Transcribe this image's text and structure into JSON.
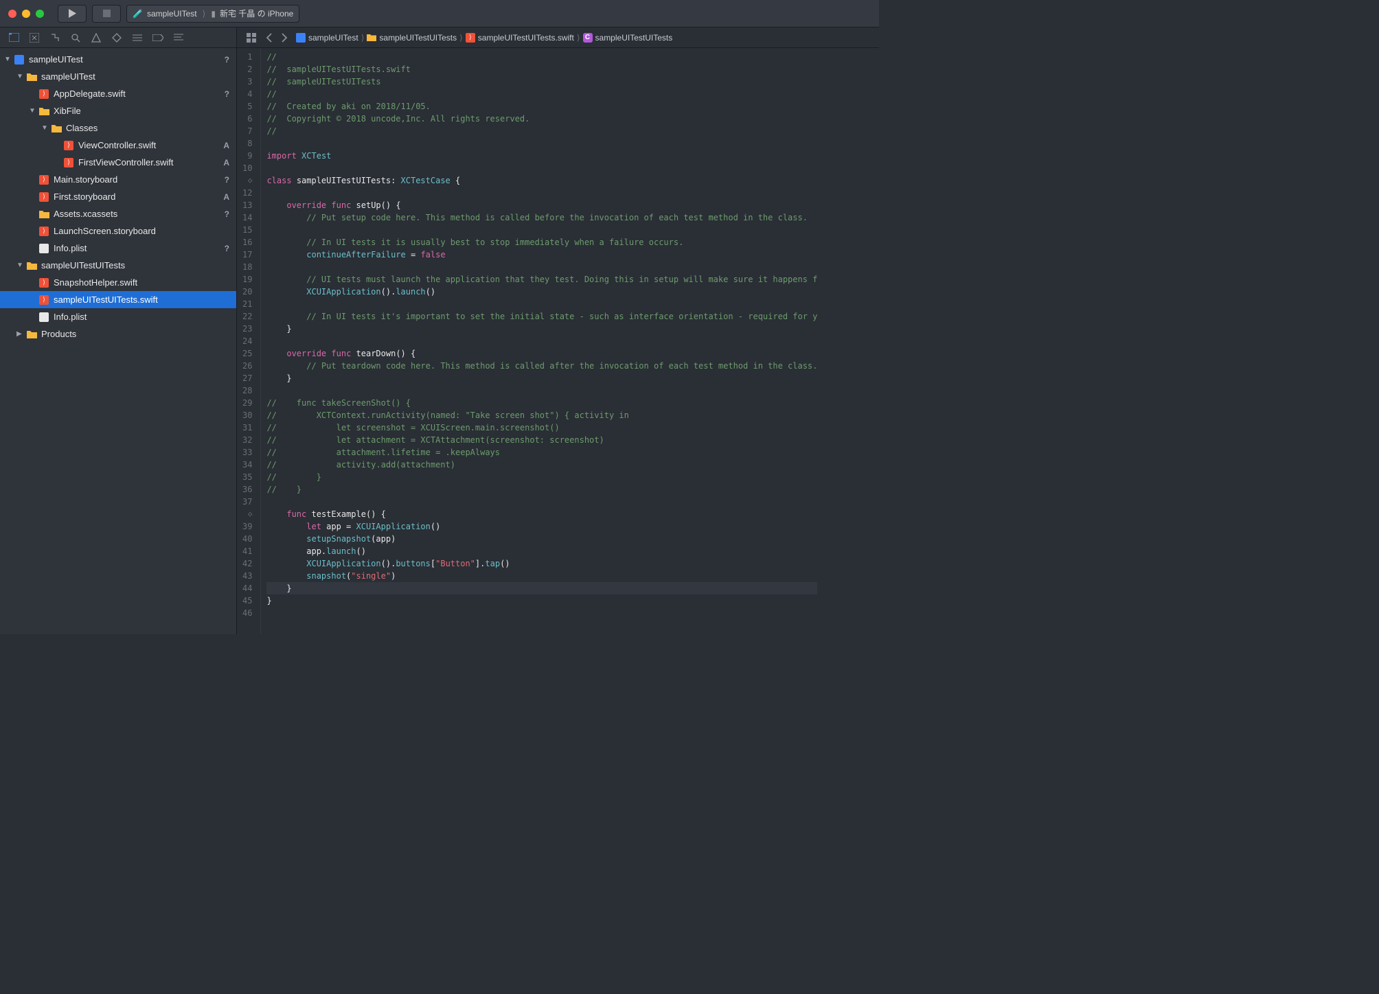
{
  "toolbar": {
    "scheme_app": "sampleUITest",
    "scheme_device": "新宅 千晶 の iPhone"
  },
  "tree": {
    "root": {
      "label": "sampleUITest",
      "badge": "?"
    },
    "items": [
      {
        "indent": 1,
        "disc": "▼",
        "type": "folder",
        "label": "sampleUITest",
        "badge": ""
      },
      {
        "indent": 2,
        "disc": "",
        "type": "swift",
        "label": "AppDelegate.swift",
        "badge": "?"
      },
      {
        "indent": 2,
        "disc": "▼",
        "type": "folder",
        "label": "XibFile",
        "badge": ""
      },
      {
        "indent": 3,
        "disc": "▼",
        "type": "folder",
        "label": "Classes",
        "badge": ""
      },
      {
        "indent": 4,
        "disc": "",
        "type": "swift",
        "label": "ViewController.swift",
        "badge": "A"
      },
      {
        "indent": 4,
        "disc": "",
        "type": "swift",
        "label": "FirstViewController.swift",
        "badge": "A"
      },
      {
        "indent": 2,
        "disc": "",
        "type": "swift",
        "label": "Main.storyboard",
        "badge": "?"
      },
      {
        "indent": 2,
        "disc": "",
        "type": "swift",
        "label": "First.storyboard",
        "badge": "A"
      },
      {
        "indent": 2,
        "disc": "",
        "type": "assets",
        "label": "Assets.xcassets",
        "badge": "?"
      },
      {
        "indent": 2,
        "disc": "",
        "type": "swift",
        "label": "LaunchScreen.storyboard",
        "badge": ""
      },
      {
        "indent": 2,
        "disc": "",
        "type": "plist",
        "label": "Info.plist",
        "badge": "?"
      },
      {
        "indent": 1,
        "disc": "▼",
        "type": "folder",
        "label": "sampleUITestUITests",
        "badge": ""
      },
      {
        "indent": 2,
        "disc": "",
        "type": "swift",
        "label": "SnapshotHelper.swift",
        "badge": ""
      },
      {
        "indent": 2,
        "disc": "",
        "type": "swift",
        "label": "sampleUITestUITests.swift",
        "badge": "",
        "selected": true
      },
      {
        "indent": 2,
        "disc": "",
        "type": "plist",
        "label": "Info.plist",
        "badge": ""
      },
      {
        "indent": 1,
        "disc": "▶",
        "type": "folder",
        "label": "Products",
        "badge": ""
      }
    ]
  },
  "breadcrumb": {
    "items": [
      {
        "icon": "proj",
        "label": "sampleUITest"
      },
      {
        "icon": "folder",
        "label": "sampleUITestUITests"
      },
      {
        "icon": "swift",
        "label": "sampleUITestUITests.swift"
      },
      {
        "icon": "class",
        "label": "sampleUITestUITests"
      }
    ]
  },
  "code": {
    "lines": [
      {
        "n": "1",
        "tokens": [
          {
            "c": "c-comment",
            "t": "//"
          }
        ]
      },
      {
        "n": "2",
        "tokens": [
          {
            "c": "c-comment",
            "t": "//  sampleUITestUITests.swift"
          }
        ]
      },
      {
        "n": "3",
        "tokens": [
          {
            "c": "c-comment",
            "t": "//  sampleUITestUITests"
          }
        ]
      },
      {
        "n": "4",
        "tokens": [
          {
            "c": "c-comment",
            "t": "//"
          }
        ]
      },
      {
        "n": "5",
        "tokens": [
          {
            "c": "c-comment",
            "t": "//  Created by aki on 2018/11/05."
          }
        ]
      },
      {
        "n": "6",
        "tokens": [
          {
            "c": "c-comment",
            "t": "//  Copyright © 2018 uncode,Inc. All rights reserved."
          }
        ]
      },
      {
        "n": "7",
        "tokens": [
          {
            "c": "c-comment",
            "t": "//"
          }
        ]
      },
      {
        "n": "8",
        "tokens": []
      },
      {
        "n": "9",
        "tokens": [
          {
            "c": "c-keyword",
            "t": "import"
          },
          {
            "c": "",
            "t": " "
          },
          {
            "c": "c-type",
            "t": "XCTest"
          }
        ]
      },
      {
        "n": "10",
        "tokens": []
      },
      {
        "n": "11",
        "gutter": "diamond",
        "tokens": [
          {
            "c": "c-keyword",
            "t": "class"
          },
          {
            "c": "",
            "t": " "
          },
          {
            "c": "c-ident",
            "t": "sampleUITestUITests: "
          },
          {
            "c": "c-type",
            "t": "XCTestCase"
          },
          {
            "c": "",
            "t": " {"
          }
        ]
      },
      {
        "n": "12",
        "tokens": []
      },
      {
        "n": "13",
        "tokens": [
          {
            "c": "",
            "t": "    "
          },
          {
            "c": "c-keyword",
            "t": "override"
          },
          {
            "c": "",
            "t": " "
          },
          {
            "c": "c-keyword",
            "t": "func"
          },
          {
            "c": "",
            "t": " "
          },
          {
            "c": "c-ident",
            "t": "setUp() {"
          }
        ]
      },
      {
        "n": "14",
        "tokens": [
          {
            "c": "",
            "t": "        "
          },
          {
            "c": "c-comment",
            "t": "// Put setup code here. This method is called before the invocation of each test method in the class."
          }
        ]
      },
      {
        "n": "15",
        "tokens": []
      },
      {
        "n": "16",
        "tokens": [
          {
            "c": "",
            "t": "        "
          },
          {
            "c": "c-comment",
            "t": "// In UI tests it is usually best to stop immediately when a failure occurs."
          }
        ]
      },
      {
        "n": "17",
        "tokens": [
          {
            "c": "",
            "t": "        "
          },
          {
            "c": "c-prop",
            "t": "continueAfterFailure"
          },
          {
            "c": "",
            "t": " = "
          },
          {
            "c": "c-keyword",
            "t": "false"
          }
        ]
      },
      {
        "n": "18",
        "tokens": []
      },
      {
        "n": "19",
        "tokens": [
          {
            "c": "",
            "t": "        "
          },
          {
            "c": "c-comment",
            "t": "// UI tests must launch the application that they test. Doing this in setup will make sure it happens f"
          }
        ]
      },
      {
        "n": "20",
        "tokens": [
          {
            "c": "",
            "t": "        "
          },
          {
            "c": "c-type",
            "t": "XCUIApplication"
          },
          {
            "c": "",
            "t": "()."
          },
          {
            "c": "c-func",
            "t": "launch"
          },
          {
            "c": "",
            "t": "()"
          }
        ]
      },
      {
        "n": "21",
        "tokens": []
      },
      {
        "n": "22",
        "tokens": [
          {
            "c": "",
            "t": "        "
          },
          {
            "c": "c-comment",
            "t": "// In UI tests it's important to set the initial state - such as interface orientation - required for y"
          }
        ]
      },
      {
        "n": "23",
        "tokens": [
          {
            "c": "",
            "t": "    }"
          }
        ]
      },
      {
        "n": "24",
        "tokens": []
      },
      {
        "n": "25",
        "tokens": [
          {
            "c": "",
            "t": "    "
          },
          {
            "c": "c-keyword",
            "t": "override"
          },
          {
            "c": "",
            "t": " "
          },
          {
            "c": "c-keyword",
            "t": "func"
          },
          {
            "c": "",
            "t": " "
          },
          {
            "c": "c-ident",
            "t": "tearDown() {"
          }
        ]
      },
      {
        "n": "26",
        "tokens": [
          {
            "c": "",
            "t": "        "
          },
          {
            "c": "c-comment",
            "t": "// Put teardown code here. This method is called after the invocation of each test method in the class."
          }
        ]
      },
      {
        "n": "27",
        "tokens": [
          {
            "c": "",
            "t": "    }"
          }
        ]
      },
      {
        "n": "28",
        "tokens": []
      },
      {
        "n": "29",
        "tokens": [
          {
            "c": "c-comment",
            "t": "//    func takeScreenShot() {"
          }
        ]
      },
      {
        "n": "30",
        "tokens": [
          {
            "c": "c-comment",
            "t": "//        XCTContext.runActivity(named: \"Take screen shot\") { activity in"
          }
        ]
      },
      {
        "n": "31",
        "tokens": [
          {
            "c": "c-comment",
            "t": "//            let screenshot = XCUIScreen.main.screenshot()"
          }
        ]
      },
      {
        "n": "32",
        "tokens": [
          {
            "c": "c-comment",
            "t": "//            let attachment = XCTAttachment(screenshot: screenshot)"
          }
        ]
      },
      {
        "n": "33",
        "tokens": [
          {
            "c": "c-comment",
            "t": "//            attachment.lifetime = .keepAlways"
          }
        ]
      },
      {
        "n": "34",
        "tokens": [
          {
            "c": "c-comment",
            "t": "//            activity.add(attachment)"
          }
        ]
      },
      {
        "n": "35",
        "tokens": [
          {
            "c": "c-comment",
            "t": "//        }"
          }
        ]
      },
      {
        "n": "36",
        "tokens": [
          {
            "c": "c-comment",
            "t": "//    }"
          }
        ]
      },
      {
        "n": "37",
        "tokens": []
      },
      {
        "n": "",
        "gutter": "diamond",
        "tokens": [
          {
            "c": "",
            "t": "    "
          },
          {
            "c": "c-keyword",
            "t": "func"
          },
          {
            "c": "",
            "t": " "
          },
          {
            "c": "c-ident",
            "t": "testExample() {"
          }
        ]
      },
      {
        "n": "39",
        "tokens": [
          {
            "c": "",
            "t": "        "
          },
          {
            "c": "c-keyword",
            "t": "let"
          },
          {
            "c": "",
            "t": " app = "
          },
          {
            "c": "c-type",
            "t": "XCUIApplication"
          },
          {
            "c": "",
            "t": "()"
          }
        ]
      },
      {
        "n": "40",
        "tokens": [
          {
            "c": "",
            "t": "        "
          },
          {
            "c": "c-func",
            "t": "setupSnapshot"
          },
          {
            "c": "",
            "t": "(app)"
          }
        ]
      },
      {
        "n": "41",
        "tokens": [
          {
            "c": "",
            "t": "        app."
          },
          {
            "c": "c-func",
            "t": "launch"
          },
          {
            "c": "",
            "t": "()"
          }
        ]
      },
      {
        "n": "42",
        "tokens": [
          {
            "c": "",
            "t": "        "
          },
          {
            "c": "c-type",
            "t": "XCUIApplication"
          },
          {
            "c": "",
            "t": "()."
          },
          {
            "c": "c-prop",
            "t": "buttons"
          },
          {
            "c": "",
            "t": "["
          },
          {
            "c": "c-string",
            "t": "\"Button\""
          },
          {
            "c": "",
            "t": "]."
          },
          {
            "c": "c-func",
            "t": "tap"
          },
          {
            "c": "",
            "t": "()"
          }
        ]
      },
      {
        "n": "43",
        "tokens": [
          {
            "c": "",
            "t": "        "
          },
          {
            "c": "c-func",
            "t": "snapshot"
          },
          {
            "c": "",
            "t": "("
          },
          {
            "c": "c-string",
            "t": "\"single\""
          },
          {
            "c": "",
            "t": ")"
          }
        ]
      },
      {
        "n": "44",
        "current": true,
        "tokens": [
          {
            "c": "",
            "t": "    }"
          }
        ]
      },
      {
        "n": "45",
        "tokens": [
          {
            "c": "",
            "t": "}"
          }
        ]
      },
      {
        "n": "46",
        "tokens": []
      }
    ]
  }
}
